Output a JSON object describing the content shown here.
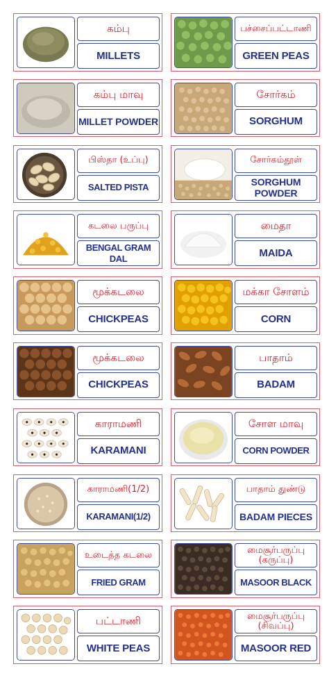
{
  "cards": [
    {
      "tamil": "கம்பு",
      "english": "MILLETS",
      "image": "millet-grains"
    },
    {
      "tamil": "பச்சைப்பட்டாணி",
      "english": "GREEN PEAS",
      "image": "green-peas"
    },
    {
      "tamil": "கம்பு மாவு",
      "english": "MILLET POWDER",
      "image": "millet-powder"
    },
    {
      "tamil": "சோர்கம்",
      "english": "SORGHUM",
      "image": "sorghum-grains"
    },
    {
      "tamil": "பிஸ்தா (உப்பு)",
      "english": "SALTED PISTA",
      "image": "pistachios"
    },
    {
      "tamil": "சோர்கம்தூள்",
      "english": "SORGHUM POWDER",
      "image": "sorghum-powder"
    },
    {
      "tamil": "கடலை பருப்பு",
      "english": "BENGAL GRAM DAL",
      "image": "bengal-gram-dal"
    },
    {
      "tamil": "மைதா",
      "english": "MAIDA",
      "image": "maida-flour"
    },
    {
      "tamil": "மூக்கடலை",
      "english": "CHICKPEAS",
      "image": "chickpeas"
    },
    {
      "tamil": "மக்கா சோளம்",
      "english": "CORN",
      "image": "corn-kernels"
    },
    {
      "tamil": "மூக்கடலை",
      "english": "CHICKPEAS",
      "image": "brown-chickpeas"
    },
    {
      "tamil": "பாதாம்",
      "english": "BADAM",
      "image": "almonds"
    },
    {
      "tamil": "காராமணி",
      "english": "KARAMANI",
      "image": "black-eyed-peas"
    },
    {
      "tamil": "சோள மாவு",
      "english": "CORN POWDER",
      "image": "corn-powder"
    },
    {
      "tamil": "காராமணி(1/2)",
      "english": "KARAMANI(1/2)",
      "image": "split-karamani"
    },
    {
      "tamil": "பாதாம் துண்டு",
      "english": "BADAM PIECES",
      "image": "almond-pieces"
    },
    {
      "tamil": "உடைத்த கடலை",
      "english": "FRIED GRAM",
      "image": "fried-gram"
    },
    {
      "tamil": "மைசூர்பருப்பு (கருப்பு)",
      "english": "MASOOR BLACK",
      "image": "masoor-black"
    },
    {
      "tamil": "பட்டாணி",
      "english": "WHITE PEAS",
      "image": "white-peas"
    },
    {
      "tamil": "மைசூர்பருப்பு (சிவப்பு)",
      "english": "MASOOR RED",
      "image": "masoor-red"
    }
  ],
  "colors": {
    "card_border": "#e05a6a",
    "box_border": "#3c4aa0",
    "tamil_text": "#e0202c",
    "english_text": "#24318a"
  }
}
